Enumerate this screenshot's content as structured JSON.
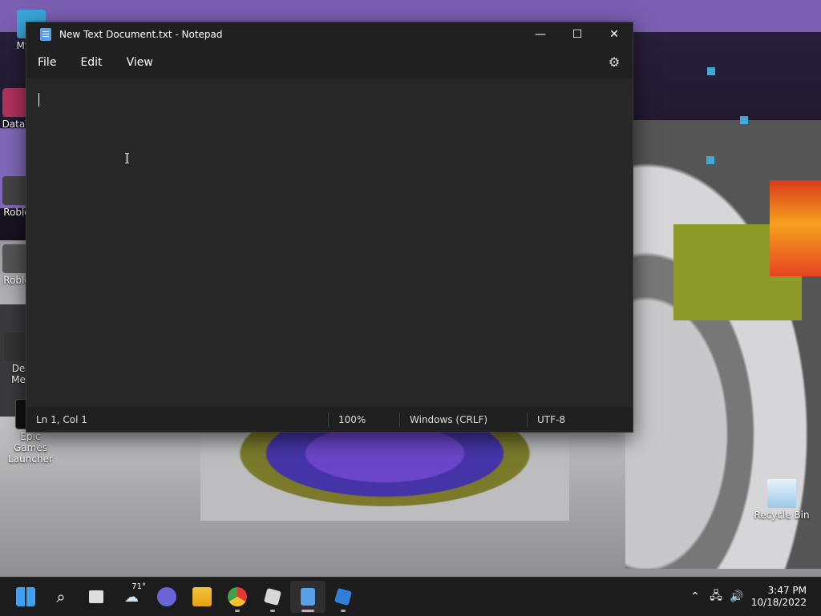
{
  "desktop": {
    "icons": [
      {
        "label": "My Co",
        "lines": 1
      },
      {
        "label": "DataV",
        "lines": 1
      },
      {
        "label": "Roblo",
        "lines": 1
      },
      {
        "label": "Roblo",
        "lines": 1
      },
      {
        "label": "De",
        "label2": "Me"
      },
      {
        "label": "Epic Games",
        "label2": "Launcher"
      },
      {
        "label": "Recycle Bin"
      }
    ]
  },
  "window": {
    "title": "New Text Document.txt - Notepad",
    "controls": {
      "minimize": "—",
      "maximize": "☐",
      "close": "✕"
    },
    "menu": [
      "File",
      "Edit",
      "View"
    ],
    "settings_icon": "gear-icon",
    "editor_text": "",
    "status": {
      "position": "Ln 1, Col 1",
      "zoom": "100%",
      "line_ending": "Windows (CRLF)",
      "encoding": "UTF-8"
    }
  },
  "taskbar": {
    "weather_temp": "71°",
    "apps": [
      "start-icon",
      "search-icon",
      "task-view-icon",
      "weather-icon",
      "teams-chat-icon",
      "file-explorer-icon",
      "chrome-icon",
      "roblox-icon",
      "notepad-icon",
      "roblox-studio-icon"
    ],
    "clock": {
      "time": "3:47 PM",
      "date": "10/18/2022"
    }
  },
  "colors": {
    "window_bg": "#202020",
    "editor_bg": "#272727",
    "taskbar_bg": "#1c1c1c",
    "accent": "#5aa0e6"
  }
}
